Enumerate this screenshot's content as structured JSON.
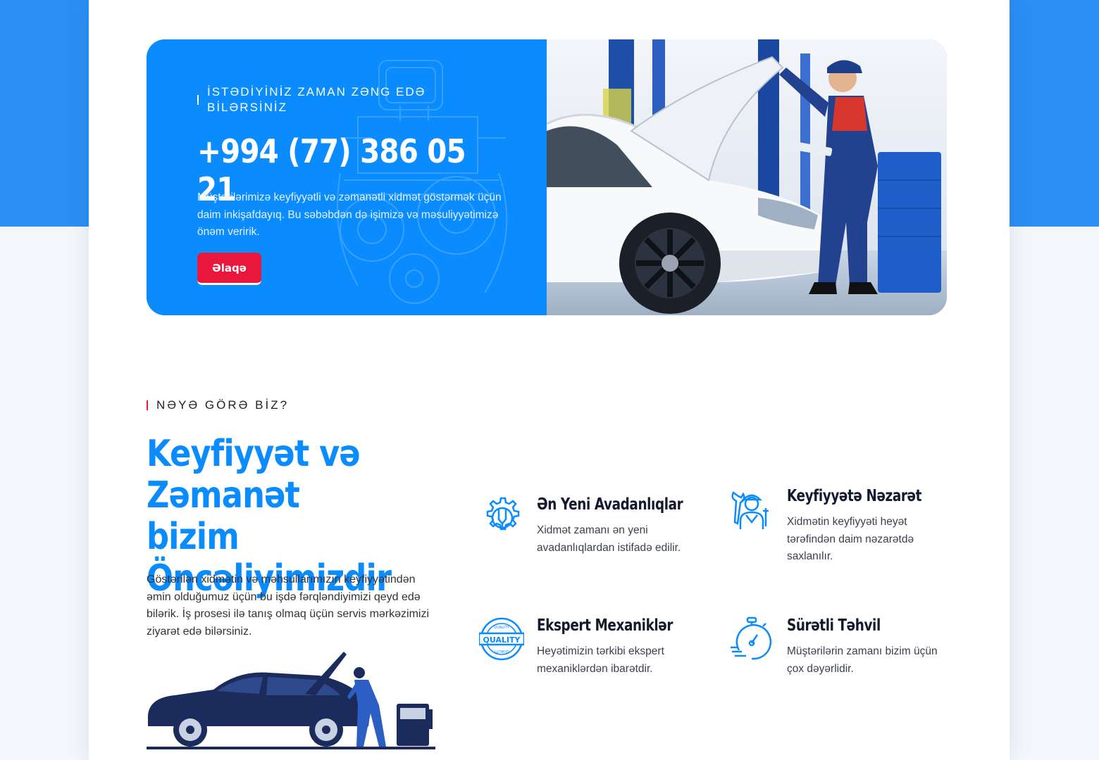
{
  "colors": {
    "brand_blue": "#0a8cff",
    "accent_red": "#e8173b",
    "band_blue": "#2b8ef5",
    "dark_text": "#141a2e"
  },
  "hero": {
    "tagline": "İSTƏDİYİNİZ ZAMAN ZƏNG EDƏ BİLƏRSİNİZ",
    "phone": "+994 (77) 386 05 21",
    "text": "Müştərilərimizə keyfiyyətli və zəmanətli xidmət göstərmək üçün daim inkişafdayıq. Bu səbəbdən də işimizə və məsuliyyətimizə önəm veririk.",
    "button_label": "Əlaqə"
  },
  "why": {
    "tag": "NƏYƏ GÖRƏ BİZ?",
    "title": "Keyfiyyət və Zəmanət bizim Öncəliyimizdir",
    "text": "Göstərilən xidmətin və məhsullarımızın keyfiyyətindən əmin olduğumuz üçün bu işdə fərqləndiyimizi qeyd edə bilərik. İş prosesi ilə tanış olmaq üçün servis mərkəzimizi ziyarət edə bilərsiniz."
  },
  "features": [
    {
      "icon": "gear-tools-icon",
      "title": "Ən Yeni Avadanlıqlar",
      "desc": "Xidmət zamanı ən yeni avadanlıqlardan istifadə edilir."
    },
    {
      "icon": "mechanic-icon",
      "title": "Keyfiyyətə Nəzarət",
      "desc": "Xidmətin keyfiyyəti heyət tərəfindən daim nəzarətdə saxlanılır."
    },
    {
      "icon": "quality-badge-icon",
      "title": "Ekspert Mexaniklər",
      "desc": "Heyətimizin tərkibi ekspert mexaniklərdən ibarətdir."
    },
    {
      "icon": "stopwatch-icon",
      "title": "Sürətli Təhvil",
      "desc": "Müştərilərin zamanı bizim üçün çox dəyərlidir."
    }
  ],
  "quality_badge": {
    "text": "QUALITY",
    "ring_top": "QUALITY",
    "ring_bottom": "QUALITY"
  }
}
